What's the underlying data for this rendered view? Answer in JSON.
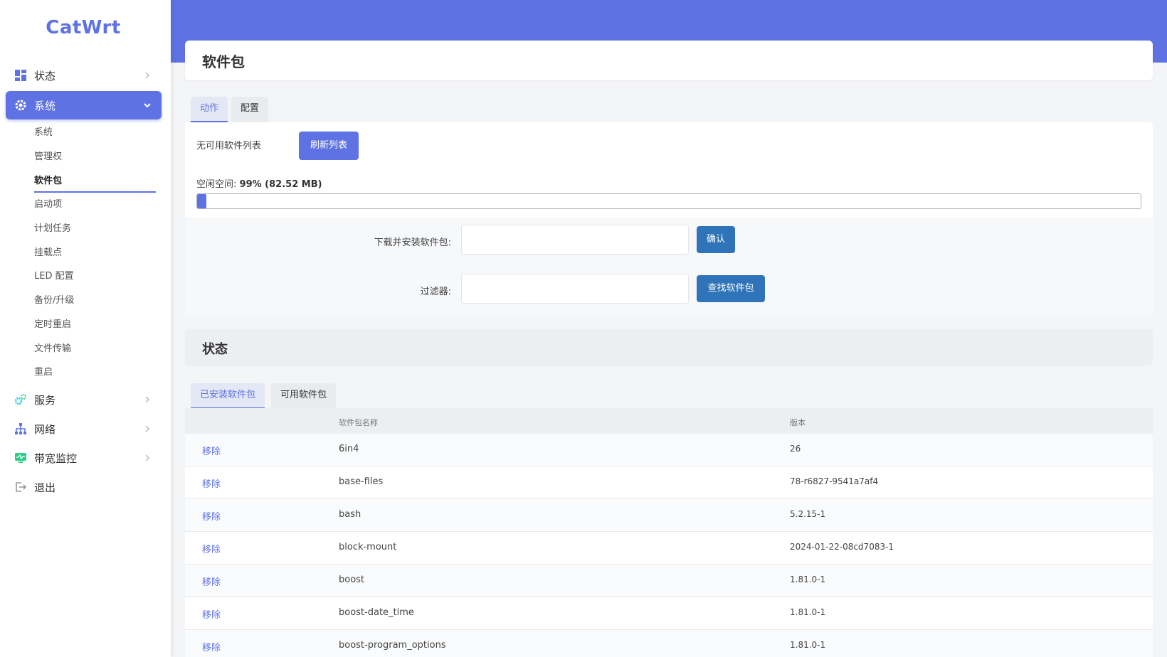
{
  "app": {
    "logo": "CatWrt"
  },
  "sidebar": {
    "main": [
      {
        "label": "状态",
        "icon": "dashboard-icon"
      },
      {
        "label": "系统",
        "icon": "gear-icon"
      },
      {
        "label": "服务",
        "icon": "services-icon"
      },
      {
        "label": "网络",
        "icon": "network-icon"
      },
      {
        "label": "带宽监控",
        "icon": "monitor-icon"
      },
      {
        "label": "退出",
        "icon": "logout-icon"
      }
    ],
    "system_sub": [
      "系统",
      "管理权",
      "软件包",
      "启动项",
      "计划任务",
      "挂载点",
      "LED 配置",
      "备份/升级",
      "定时重启",
      "文件传输",
      "重启"
    ]
  },
  "page": {
    "title": "软件包"
  },
  "action_tabs": [
    "动作",
    "配置"
  ],
  "actions": {
    "no_list": "无可用软件列表",
    "refresh_label": "刷新列表",
    "free_space_label": "空闲空间:",
    "free_space_value": "99% (82.52 MB)",
    "used_fraction": 0.01,
    "download_label": "下载并安装软件包:",
    "confirm_label": "确认",
    "filter_label": "过滤器:",
    "find_label": "查找软件包"
  },
  "status": {
    "title": "状态"
  },
  "pkg_tabs": [
    "已安装软件包",
    "可用软件包"
  ],
  "table": {
    "headers": [
      "软件包名称",
      "版本"
    ],
    "remove_label": "移除",
    "rows": [
      {
        "name": "6in4",
        "version": "26"
      },
      {
        "name": "base-files",
        "version": "78-r6827-9541a7af4"
      },
      {
        "name": "bash",
        "version": "5.2.15-1"
      },
      {
        "name": "block-mount",
        "version": "2024-01-22-08cd7083-1"
      },
      {
        "name": "boost",
        "version": "1.81.0-1"
      },
      {
        "name": "boost-date_time",
        "version": "1.81.0-1"
      },
      {
        "name": "boost-program_options",
        "version": "1.81.0-1"
      }
    ]
  },
  "colors": {
    "accent": "#5e72e4",
    "button_blue": "#2f73b8"
  }
}
